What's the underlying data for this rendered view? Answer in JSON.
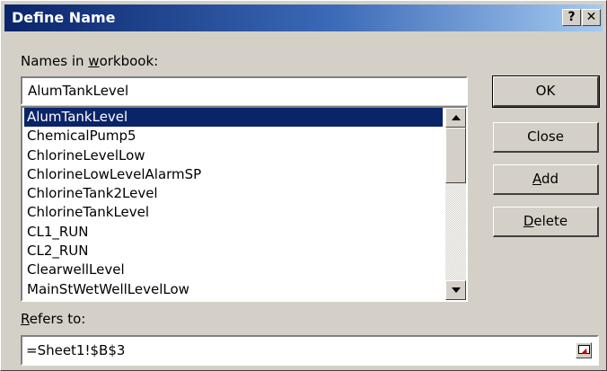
{
  "window": {
    "title": "Define Name",
    "help_label": "?",
    "close_label": "✕"
  },
  "names_label_prefix": "Names in ",
  "names_label_underlined": "w",
  "names_label_suffix": "orkbook:",
  "name_value": "AlumTankLevel",
  "names_list": [
    "AlumTankLevel",
    "ChemicalPump5",
    "ChlorineLevelLow",
    "ChlorineLowLevelAlarmSP",
    "ChlorineTank2Level",
    "ChlorineTankLevel",
    "CL1_RUN",
    "CL2_RUN",
    "ClearwellLevel",
    "MainStWetWellLevelLow"
  ],
  "selected_index": 0,
  "buttons": {
    "ok": "OK",
    "close": "Close",
    "add_underlined": "A",
    "add_rest": "dd",
    "delete_underlined": "D",
    "delete_rest": "elete"
  },
  "refers_label_underlined": "R",
  "refers_label_rest": "efers to:",
  "refers_value": "=Sheet1!$B$3",
  "colors": {
    "title_gradient_start": "#0a246a",
    "title_gradient_end": "#a6caf0",
    "selection": "#0a246a",
    "face": "#d4d0c8"
  }
}
